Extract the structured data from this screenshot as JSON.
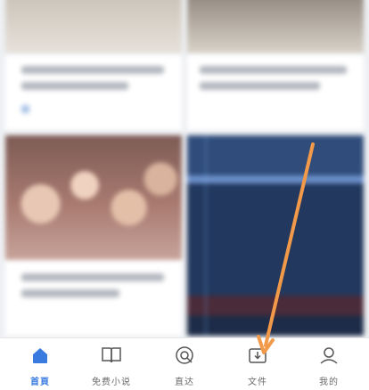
{
  "tabbar": {
    "items": [
      {
        "label": "首頁",
        "icon": "home-icon",
        "active": true
      },
      {
        "label": "免费小说",
        "icon": "book-icon",
        "active": false
      },
      {
        "label": "直达",
        "icon": "direct-search-icon",
        "active": false
      },
      {
        "label": "文件",
        "icon": "download-file-icon",
        "active": false
      },
      {
        "label": "我的",
        "icon": "profile-icon",
        "active": false
      }
    ]
  },
  "colors": {
    "accent": "#3a7be0",
    "inactive": "#6b6b6b",
    "annotation_arrow": "#f29a4a"
  }
}
